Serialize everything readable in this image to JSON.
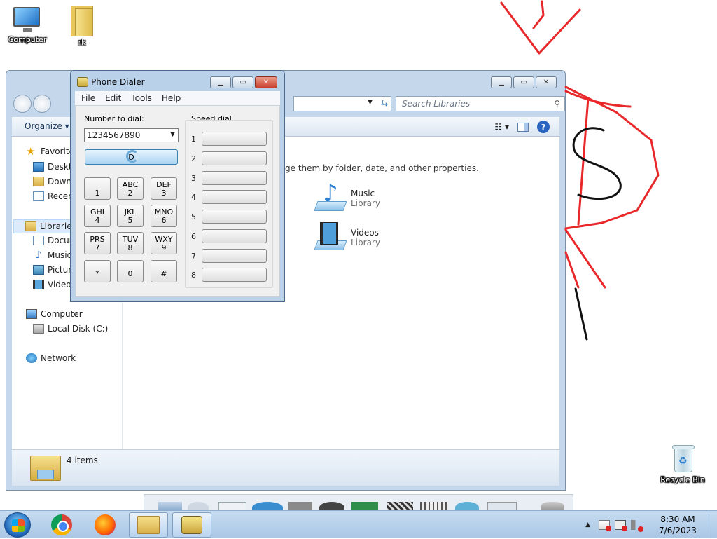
{
  "desktop": {
    "icons": [
      {
        "label": "Computer"
      },
      {
        "label": "rk"
      },
      {
        "label": "Recycle Bin"
      }
    ]
  },
  "explorer": {
    "search_placeholder": "Search Libraries",
    "toolbar": {
      "organize": "Organize ▾",
      "help": "?"
    },
    "nav": {
      "favorites": "Favorites",
      "desktop": "Desktop",
      "downloads": "Downloads",
      "recent": "Recent Places",
      "libraries": "Libraries",
      "documents": "Documents",
      "music": "Music",
      "pictures": "Pictures",
      "videos": "Videos",
      "computer": "Computer",
      "local_disk": "Local Disk (C:)",
      "network": "Network"
    },
    "content": {
      "hint": "ge them by folder, date, and other properties.",
      "libraries": [
        {
          "name": "Music",
          "type": "Library"
        },
        {
          "name": "Videos",
          "type": "Library"
        }
      ]
    },
    "status": {
      "count": "4 items"
    }
  },
  "dialer": {
    "title": "Phone Dialer",
    "menu": [
      "File",
      "Edit",
      "Tools",
      "Help"
    ],
    "number_label": "Number to dial:",
    "number_value": "1234567890",
    "dial_label": "D",
    "speed_label": "Speed dial",
    "keys": [
      {
        "letters": "",
        "digit": "1"
      },
      {
        "letters": "ABC",
        "digit": "2"
      },
      {
        "letters": "DEF",
        "digit": "3"
      },
      {
        "letters": "GHI",
        "digit": "4"
      },
      {
        "letters": "JKL",
        "digit": "5"
      },
      {
        "letters": "MNO",
        "digit": "6"
      },
      {
        "letters": "PRS",
        "digit": "7"
      },
      {
        "letters": "TUV",
        "digit": "8"
      },
      {
        "letters": "WXY",
        "digit": "9"
      },
      {
        "letters": "",
        "digit": "*"
      },
      {
        "letters": "",
        "digit": "0"
      },
      {
        "letters": "",
        "digit": "#"
      }
    ],
    "speed_slots": [
      "1",
      "2",
      "3",
      "4",
      "5",
      "6",
      "7",
      "8"
    ]
  },
  "taskbar": {
    "time": "8:30 AM",
    "date": "7/6/2023",
    "tray_arrow": "▲"
  }
}
